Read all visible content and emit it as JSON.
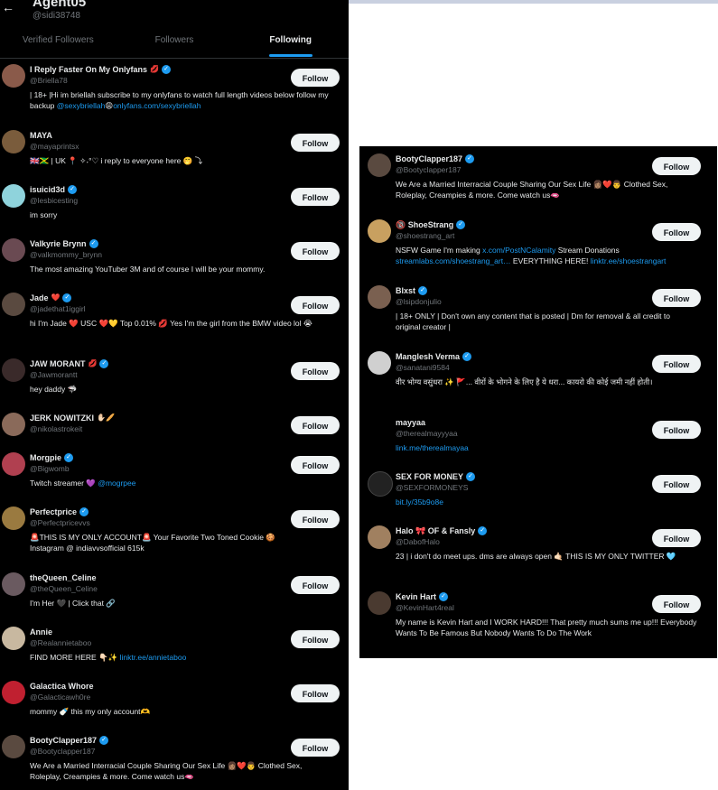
{
  "left": {
    "header": {
      "back_icon": "back-arrow-icon",
      "title": "Agent05",
      "handle": "@sidi38748"
    },
    "tabs": [
      {
        "label": "Verified Followers",
        "active": false
      },
      {
        "label": "Followers",
        "active": false
      },
      {
        "label": "Following",
        "active": true
      }
    ],
    "follow_label": "Follow",
    "users": [
      {
        "name": "I Reply Faster On My Onlyfans",
        "name_emoji": "💋",
        "verified": true,
        "handle": "@Briella78",
        "bio": "| 18+ |Hi im briellah subscribe to my onlyfans to watch full length videos below follow my backup",
        "bio_link": "@sexybriellah",
        "bio_emoji": "😩",
        "bio_link2": "onlyfans.com/sexybriellah",
        "avatar_color": "#8a5a4a"
      },
      {
        "name": "MAYA",
        "verified": false,
        "handle": "@mayaprintsx",
        "bio": "🇬🇧🇯🇲 | UK 📍 ✧˖°♡ i reply to everyone here 🤭 ⤵",
        "avatar_color": "#7a5c3c"
      },
      {
        "name": "isuicid3d",
        "verified": true,
        "handle": "@lesbicesting",
        "bio": "im sorry",
        "avatar_color": "#8fd3dc"
      },
      {
        "name": "Valkyrie Brynn",
        "verified": true,
        "handle": "@valkmommy_brynn",
        "bio": "The most amazing YouTuber 3M and of course I will be your mommy.",
        "avatar_color": "#6a4a52"
      },
      {
        "name": "Jade",
        "name_emoji": "❤️",
        "verified": true,
        "handle": "@jadethat1iggirl",
        "bio": "hi I'm Jade ❤️ USC ❤️💛 Top 0.01% 💋 Yes I'm the girl from the BMW video lol 😭",
        "avatar_color": "#5a4a40"
      },
      {
        "name": "JAW MORANT",
        "name_emoji": "💋",
        "verified": true,
        "handle": "@Jawmorantt",
        "bio": "hey daddy 🦈",
        "avatar_color": "#3a2a2a"
      },
      {
        "name": "JERK NOWITZKI",
        "name_emoji": "✋🏻🥖",
        "verified": false,
        "handle": "@nikolastrokeit",
        "bio": "",
        "avatar_color": "#8a6a5a"
      },
      {
        "name": "Morgpie",
        "verified": true,
        "handle": "@Bigwomb",
        "bio": "Twitch streamer 💜",
        "bio_link": "@mogrpee",
        "avatar_color": "#b04050"
      },
      {
        "name": "Perfectprice",
        "verified": true,
        "handle": "@Perfectpricevvs",
        "bio": "🚨THIS IS MY ONLY ACCOUNT🚨 Your Favorite Two Toned Cookie 🍪 Instagram @ indiavvsofficial 615k",
        "avatar_color": "#9a7a40"
      },
      {
        "name": "theQueen_Celine",
        "verified": false,
        "handle": "@theQueen_Celine",
        "bio": "I'm Her 🖤 | Click that 🔗",
        "avatar_color": "#6a5a60"
      },
      {
        "name": "Annie",
        "verified": false,
        "handle": "@Realannietaboo",
        "bio": "FIND MORE HERE 👇🏻✨",
        "bio_link": "linktr.ee/annietaboo",
        "avatar_color": "#c8b8a0"
      },
      {
        "name": "Galactica Whore",
        "verified": false,
        "handle": "@Galacticawh0re",
        "bio": "mommy 🍼 this my only account🫶",
        "avatar_color": "#c02030"
      },
      {
        "name": "BootyClapper187",
        "verified": true,
        "handle": "@Bootyclapper187",
        "bio": "We Are a Married Interracial Couple Sharing Our Sex Life 👩🏽‍❤️‍👨 Clothed Sex, Roleplay, Creampies & more. Come watch us🫦",
        "avatar_color": "#5a4a40"
      }
    ]
  },
  "right": {
    "follow_label": "Follow",
    "users": [
      {
        "name": "BootyClapper187",
        "verified": true,
        "handle": "@Bootyclapper187",
        "bio": "We Are a Married Interracial Couple Sharing Our Sex Life 👩🏽‍❤️‍👨 Clothed Sex, Roleplay, Creampies & more. Come watch us🫦",
        "avatar_color": "#5a4a40"
      },
      {
        "name": "🔞 ShoeStrang",
        "verified": true,
        "handle": "@shoestrang_art",
        "bio": "NSFW Game I'm making",
        "bio_link": "x.com/PostNCalamity",
        "bio_mid": " Stream Donations ",
        "bio_link2": "streamlabs.com/shoestrang_art…",
        "bio_end": " EVERYTHING HERE! ",
        "bio_link3": "linktr.ee/shoestrangart",
        "avatar_color": "#c8a060"
      },
      {
        "name": "Blxst",
        "verified": true,
        "handle": "@lsipdonjulio",
        "bio": "| 18+ ONLY | Don't own any content that is posted | Dm for removal & all credit to original creator |",
        "avatar_color": "#7a6050"
      },
      {
        "name": "Manglesh Verma",
        "verified": true,
        "handle": "@sanatani9584",
        "bio": "वीर भोग्य वसुंधरा ✨ 🚩... वीरों के भोगने के लिए है ये धरा... कायरो की कोई जमी नहीं होती।",
        "avatar_color": "#d0d0d0"
      },
      {
        "name": "mayyaa",
        "verified": false,
        "handle": "@therealmayyyaa",
        "bio": "",
        "bio_link": "link.me/therealmayaa",
        "avatar_color": "#000000"
      },
      {
        "name": "SEX FOR MONEY",
        "verified": true,
        "handle": "@SEXFORMONEYS",
        "bio": "",
        "bio_link": "bit.ly/35b9o8e",
        "avatar_color": "#222222"
      },
      {
        "name": "Halo 🎀 OF & Fansly",
        "verified": true,
        "handle": "@DabofHalo",
        "bio": "23 | i don't do meet ups. dms are always open 🤙🏻 THIS IS MY ONLY TWITTER 🩵",
        "avatar_color": "#a08060"
      },
      {
        "name": "Kevin Hart",
        "verified": true,
        "handle": "@KevinHart4real",
        "bio": "My name is Kevin Hart and I WORK HARD!!! That pretty much sums me up!!! Everybody Wants To Be Famous But Nobody Wants To Do The Work",
        "avatar_color": "#4a3a30"
      }
    ]
  }
}
